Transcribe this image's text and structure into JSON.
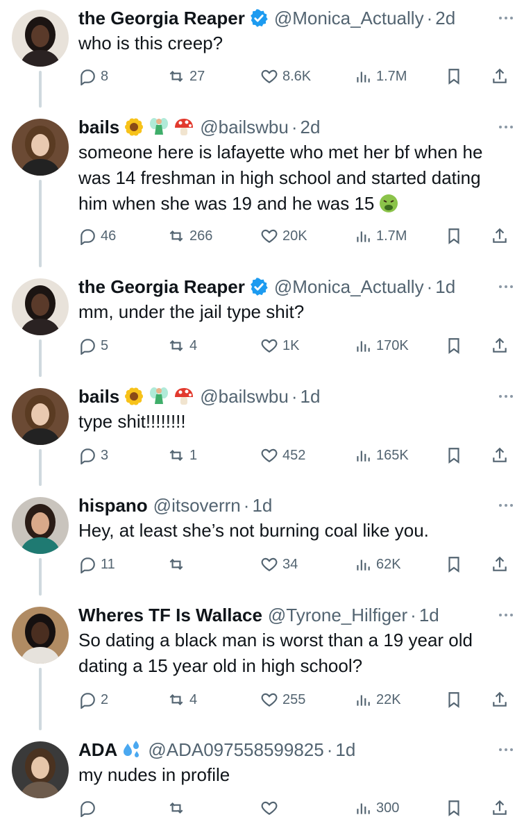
{
  "tweets": [
    {
      "name": "the Georgia Reaper",
      "verified": true,
      "emojis": [],
      "handle": "@Monica_Actually",
      "time": "2d",
      "text": "who is this creep?",
      "text_emoji": "",
      "replies": "8",
      "retweets": "27",
      "likes": "8.6K",
      "views": "1.7M",
      "avatar_colors": {
        "bg": "#e8e2da",
        "skin": "#5a3a2a",
        "hair": "#1b1412",
        "cloth": "#2a2222"
      }
    },
    {
      "name": "bails",
      "verified": false,
      "emojis": [
        "sunflower-icon",
        "fairy-icon",
        "mushroom-icon"
      ],
      "handle": "@bailswbu",
      "time": "2d",
      "text": "someone here is lafayette who met her bf when he was 14 freshman in high school and started dating him when she was 19 and he was 15",
      "text_emoji": "nauseated-face-icon",
      "replies": "46",
      "retweets": "266",
      "likes": "20K",
      "views": "1.7M",
      "avatar_colors": {
        "bg": "#6b4a34",
        "skin": "#e9c9b0",
        "hair": "#5a3b22",
        "cloth": "#222222"
      }
    },
    {
      "name": "the Georgia Reaper",
      "verified": true,
      "emojis": [],
      "handle": "@Monica_Actually",
      "time": "1d",
      "text": "mm, under the jail type shit?",
      "text_emoji": "",
      "replies": "5",
      "retweets": "4",
      "likes": "1K",
      "views": "170K",
      "avatar_colors": {
        "bg": "#e8e2da",
        "skin": "#5a3a2a",
        "hair": "#1b1412",
        "cloth": "#2a2222"
      }
    },
    {
      "name": "bails",
      "verified": false,
      "emojis": [
        "sunflower-icon",
        "fairy-icon",
        "mushroom-icon"
      ],
      "handle": "@bailswbu",
      "time": "1d",
      "text": "type shit!!!!!!!!",
      "text_emoji": "",
      "replies": "3",
      "retweets": "1",
      "likes": "452",
      "views": "165K",
      "avatar_colors": {
        "bg": "#6b4a34",
        "skin": "#e9c9b0",
        "hair": "#5a3b22",
        "cloth": "#222222"
      }
    },
    {
      "name": "hispano",
      "verified": false,
      "emojis": [],
      "handle": "@itsoverrn",
      "time": "1d",
      "text": "Hey, at least she’s not burning coal like you.",
      "text_emoji": "",
      "replies": "11",
      "retweets": "",
      "likes": "34",
      "views": "62K",
      "avatar_colors": {
        "bg": "#c9c4bd",
        "skin": "#d9a98a",
        "hair": "#2a1c16",
        "cloth": "#1f7a72"
      }
    },
    {
      "name": "Wheres TF Is Wallace",
      "verified": false,
      "emojis": [],
      "handle": "@Tyrone_Hilfiger",
      "time": "1d",
      "text": "So dating a black man is worst than a 19 year old dating a 15 year old in high school?",
      "text_emoji": "",
      "replies": "2",
      "retweets": "4",
      "likes": "255",
      "views": "22K",
      "avatar_colors": {
        "bg": "#b08b63",
        "skin": "#4a2e20",
        "hair": "#151010",
        "cloth": "#e6e2dc"
      }
    },
    {
      "name": "ADA",
      "verified": false,
      "emojis": [
        "sweat-droplets-icon"
      ],
      "handle": "@ADA097558599825",
      "time": "1d",
      "text": "my nudes in profile",
      "text_emoji": "",
      "replies": "",
      "retweets": "",
      "likes": "",
      "views": "300",
      "avatar_colors": {
        "bg": "#3a3a3a",
        "skin": "#e6c6aa",
        "hair": "#4a3220",
        "cloth": "#6d5b4c"
      }
    }
  ],
  "colors": {
    "text": "#0f1419",
    "secondary": "#536471",
    "verified": "#1d9bf0",
    "thread_line": "#cfd9de"
  }
}
